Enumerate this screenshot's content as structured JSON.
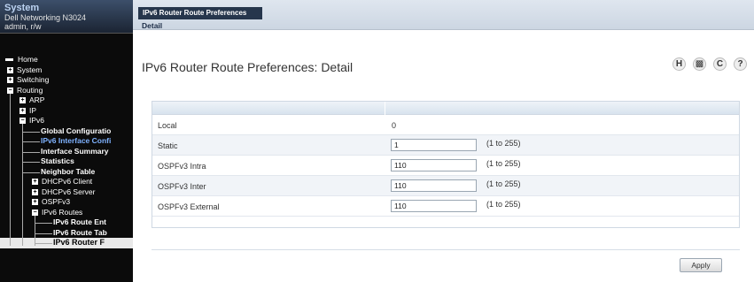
{
  "sidebar": {
    "title": "System",
    "device": "Dell Networking N3024",
    "user": "admin, r/w",
    "tree": [
      {
        "label": "Home"
      },
      {
        "label": "System",
        "pm": "+"
      },
      {
        "label": "Switching",
        "pm": "+"
      },
      {
        "label": "Routing",
        "pm": "−"
      },
      {
        "label": "ARP",
        "pm": "+"
      },
      {
        "label": "IP",
        "pm": "+"
      },
      {
        "label": "IPv6",
        "pm": "−"
      },
      {
        "label": "Global Configuratio"
      },
      {
        "label": "IPv6 Interface Confi"
      },
      {
        "label": "Interface Summary"
      },
      {
        "label": "Statistics"
      },
      {
        "label": "Neighbor Table"
      },
      {
        "label": "DHCPv6 Client",
        "pm": "+"
      },
      {
        "label": "DHCPv6 Server",
        "pm": "+"
      },
      {
        "label": "OSPFv3",
        "pm": "+"
      },
      {
        "label": "IPv6 Routes",
        "pm": "−"
      },
      {
        "label": "IPv6 Route Ent"
      },
      {
        "label": "IPv6 Route Tab"
      },
      {
        "label": "IPv6 Router F"
      }
    ]
  },
  "tabs": {
    "main": "IPv6 Router Route Preferences",
    "sub": "Detail"
  },
  "page": {
    "title": "IPv6 Router Route Preferences: Detail"
  },
  "icons": {
    "help_h": "H",
    "refresh": "C",
    "question": "?"
  },
  "rows": {
    "local": {
      "label": "Local",
      "value": "0"
    },
    "static": {
      "label": "Static",
      "value": "1",
      "range": "(1 to 255)"
    },
    "ospf_intra": {
      "label": "OSPFv3 Intra",
      "value": "110",
      "range": "(1 to 255)"
    },
    "ospf_inter": {
      "label": "OSPFv3 Inter",
      "value": "110",
      "range": "(1 to 255)"
    },
    "ospf_external": {
      "label": "OSPFv3 External",
      "value": "110",
      "range": "(1 to 255)"
    }
  },
  "apply_label": "Apply"
}
